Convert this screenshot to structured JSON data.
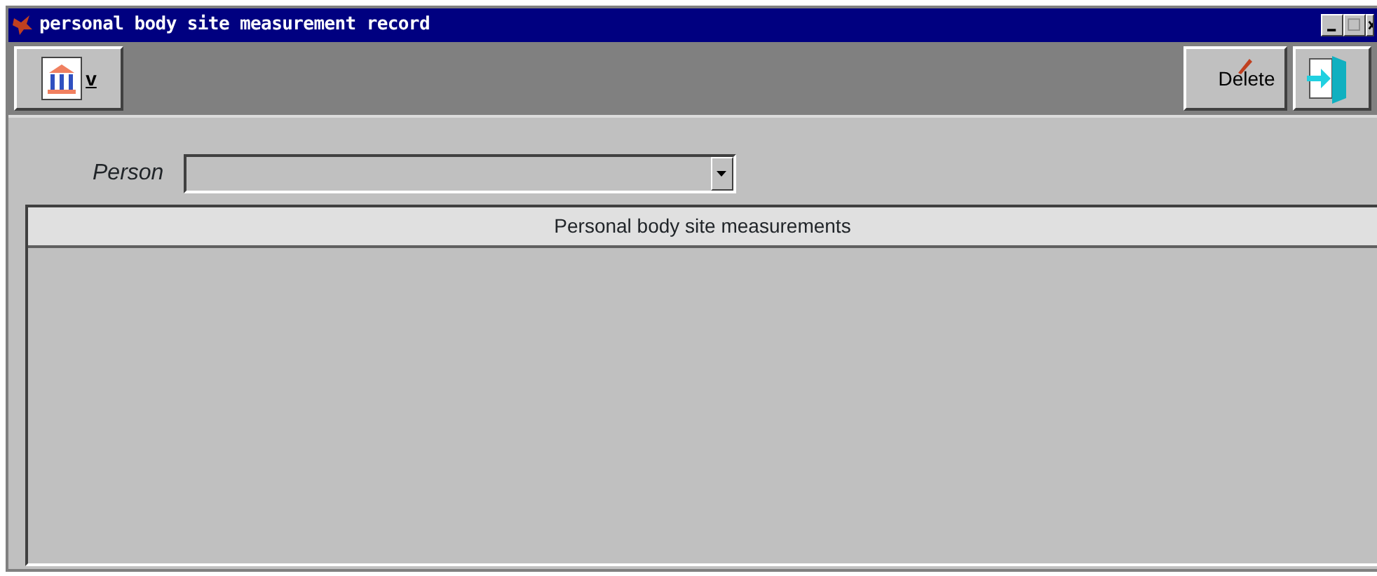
{
  "window": {
    "title": "personal body site measurement record"
  },
  "toolbar": {
    "left": [
      {
        "kind": "menu",
        "label": "v"
      }
    ],
    "right": [
      {
        "kind": "delete",
        "label": "Delete"
      },
      {
        "kind": "exit"
      }
    ]
  },
  "form": {
    "person_label": "Person"
  },
  "grid": {
    "title": "Personal body site measurements"
  }
}
